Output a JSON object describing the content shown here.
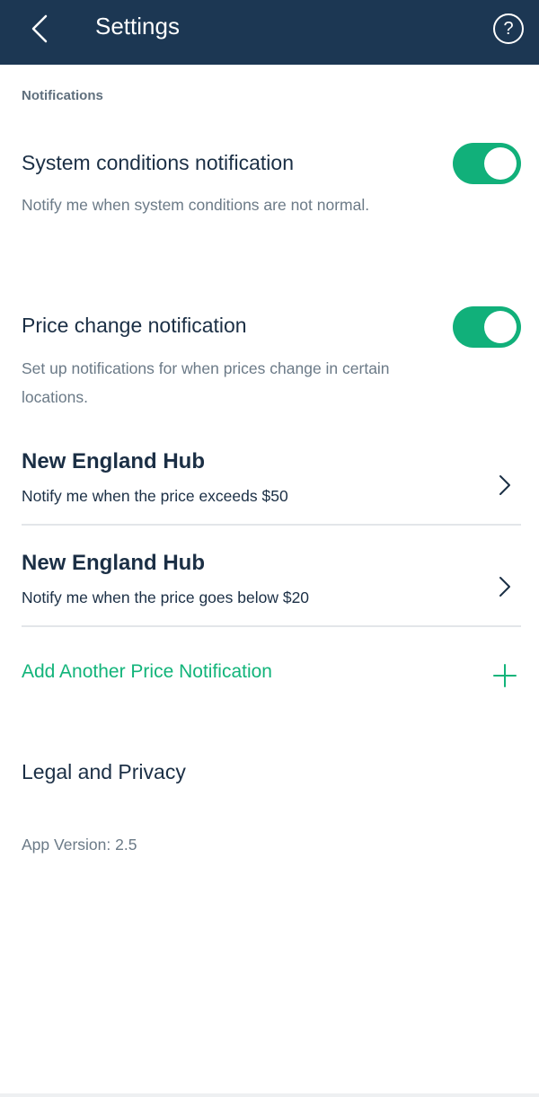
{
  "header": {
    "title": "Settings",
    "help_label": "?",
    "back_icon": "chevron-left-icon",
    "help_icon": "question-circle-icon",
    "background_color": "#1c3753"
  },
  "notifications": {
    "section_label": "Notifications",
    "system": {
      "title": "System conditions notification",
      "description": "Notify me when system conditions are not normal.",
      "enabled": true
    },
    "price": {
      "title": "Price change notification",
      "description": "Set up notifications for when prices change in certain locations.",
      "enabled": true
    },
    "price_alerts": [
      {
        "hub": "New England Hub",
        "rule": "Notify me when the price exceeds $50"
      },
      {
        "hub": "New England Hub",
        "rule": "Notify me when the price goes below $20"
      }
    ],
    "add_label": "Add Another Price Notification",
    "accent_color": "#11b07a"
  },
  "legal_label": "Legal and Privacy",
  "app_version": "App Version: 2.5"
}
